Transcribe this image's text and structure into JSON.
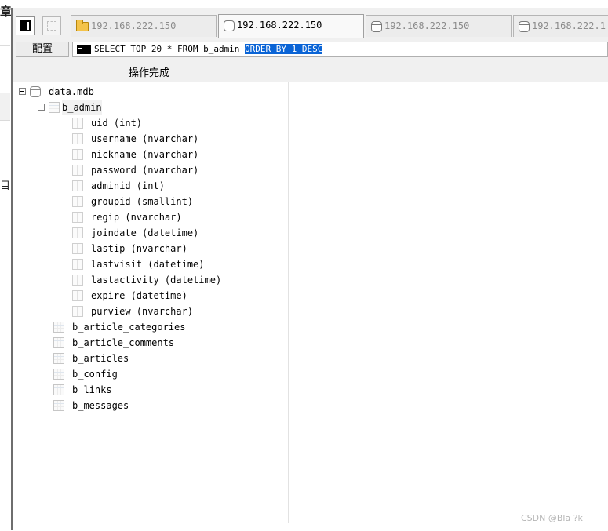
{
  "background": {
    "chars": [
      "章",
      "目"
    ]
  },
  "tabs": [
    {
      "label": "192.168.222.150",
      "icon": "folder-icon",
      "active": false
    },
    {
      "label": "192.168.222.150",
      "icon": "database-icon",
      "active": true
    },
    {
      "label": "192.168.222.150",
      "icon": "database-icon",
      "active": false
    },
    {
      "label": "192.168.222.1",
      "icon": "database-icon",
      "active": false
    }
  ],
  "toolbar": {
    "config_label": "配置",
    "command_plain": "SELECT TOP 20 * FROM b_admin ",
    "command_selected": "ORDER BY 1 DESC"
  },
  "status": {
    "text": "操作完成"
  },
  "tree": {
    "database": "data.mdb",
    "expanded_table": "b_admin",
    "columns": [
      "uid (int)",
      "username (nvarchar)",
      "nickname (nvarchar)",
      "password (nvarchar)",
      "adminid (int)",
      "groupid (smallint)",
      "regip (nvarchar)",
      "joindate (datetime)",
      "lastip (nvarchar)",
      "lastvisit (datetime)",
      "lastactivity (datetime)",
      "expire (datetime)",
      "purview (nvarchar)"
    ],
    "other_tables": [
      "b_article_categories",
      "b_article_comments",
      "b_articles",
      "b_config",
      "b_links",
      "b_messages"
    ]
  },
  "watermark": "CSDN @Bla ?k",
  "colors": {
    "selection": "#0a64d6",
    "panel": "#f0f0f0"
  }
}
